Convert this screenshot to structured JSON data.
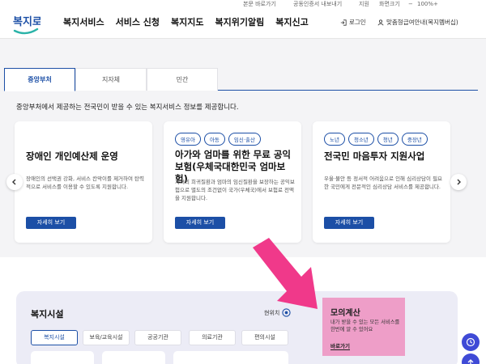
{
  "utility": {
    "links": [
      "본문 바로가기",
      "공동인증서 내보내기",
      "지원",
      "화면크기",
      "100%"
    ],
    "zoom_out": "−",
    "zoom_in": "+"
  },
  "header": {
    "logo_text": "복지로",
    "nav": [
      "복지서비스",
      "서비스 신청",
      "복지지도",
      "복지위기알림",
      "복지신고"
    ],
    "login": "로그인",
    "guide": "맞춤형급여안내(복지멤버십)"
  },
  "tabs": [
    {
      "label": "중앙부처",
      "active": true
    },
    {
      "label": "지자체",
      "active": false
    },
    {
      "label": "민간",
      "active": false
    }
  ],
  "intro": "중앙부처에서 제공하는 전국민이 받을 수 있는 복지서비스 정보를 제공합니다.",
  "cards": [
    {
      "chips": [],
      "title": "장애인 개인예산제 운영",
      "desc": "장애인의 선택권 강화, 서비스 칸막이를 제거하여 탄력적으로 서비스를 이용할 수 있도록 지원합니다.",
      "button": "자세히 보기"
    },
    {
      "chips": [
        "영유아",
        "아동",
        "임신·출산"
      ],
      "title": "아가와 엄마를 위한 무료 공익보험(우체국대한민국 엄마보험)",
      "desc": "자녀의 희귀질환과 엄마의 임신질환을 보장하는 공익보험으로 별도의 조건없이 국가(우체국)에서 보험료 전액을 지원합니다.",
      "button": "자세히 보기"
    },
    {
      "chips": [
        "노년",
        "청소년",
        "청년",
        "중장년"
      ],
      "title": "전국민 마음투자 지원사업",
      "desc": "우울·불안 등 정서적 어려움으로 인해 심리상담이 필요한 국민에게 전문적인 심리상담 서비스를 제공합니다.",
      "button": "자세히 보기"
    }
  ],
  "facilities": {
    "title": "복지시설",
    "location": "현위치",
    "filters": [
      {
        "label": "복지시설",
        "active": true
      },
      {
        "label": "보육/교육시설",
        "active": false
      },
      {
        "label": "공공기관",
        "active": false
      },
      {
        "label": "의료기관",
        "active": false
      },
      {
        "label": "편의시설",
        "active": false
      }
    ]
  },
  "simulation": {
    "title": "모의계산",
    "desc": "내가 받을 수 있는 모든 서비스를 한번에 알 수 있어요",
    "link": "바로가기"
  },
  "colors": {
    "brand": "#1c4fa6",
    "highlight": "#ee9ec8",
    "pink_arrow": "#f0398a",
    "float": "#3f4ad6"
  }
}
